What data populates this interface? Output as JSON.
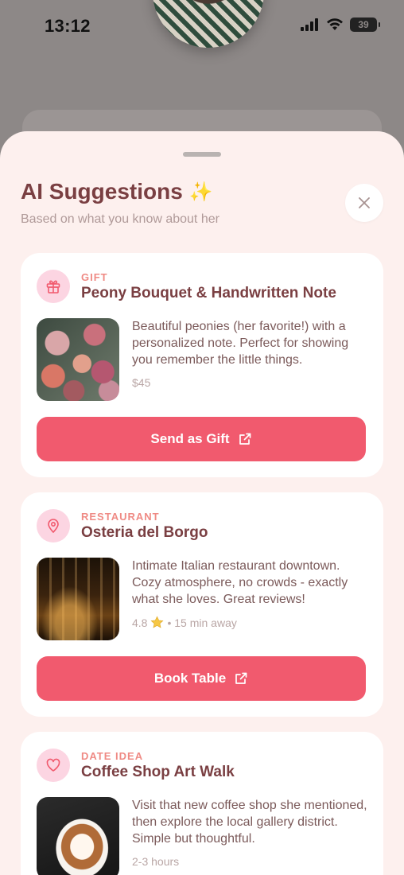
{
  "status_bar": {
    "time": "13:12",
    "battery": "39"
  },
  "sheet": {
    "title": "AI Suggestions",
    "title_emoji": "✨",
    "subtitle": "Based on what you know about her"
  },
  "suggestions": [
    {
      "category": "GIFT",
      "title": "Peony Bouquet & Handwritten Note",
      "description": "Beautiful peonies (her favorite!) with a personalized note. Perfect for showing you remember the little things.",
      "meta": "$45",
      "action_label": "Send as Gift",
      "icon": "gift-icon"
    },
    {
      "category": "RESTAURANT",
      "title": "Osteria del Borgo",
      "description": "Intimate Italian restaurant downtown. Cozy atmosphere, no crowds - exactly what she loves. Great reviews!",
      "meta_rating": "4.8",
      "meta_rest": "• 15 min away",
      "action_label": "Book Table",
      "icon": "location-pin-icon"
    },
    {
      "category": "DATE IDEA",
      "title": "Coffee Shop Art Walk",
      "description": "Visit that new coffee shop she mentioned, then explore the local gallery district. Simple but thoughtful.",
      "meta": "2-3 hours",
      "icon": "heart-icon"
    }
  ],
  "colors": {
    "accent": "#f15a6e",
    "title": "#7a3f42",
    "category": "#ef8a84",
    "icon_bg": "#fcd5e2",
    "sheet_bg": "#fdf0ee"
  }
}
